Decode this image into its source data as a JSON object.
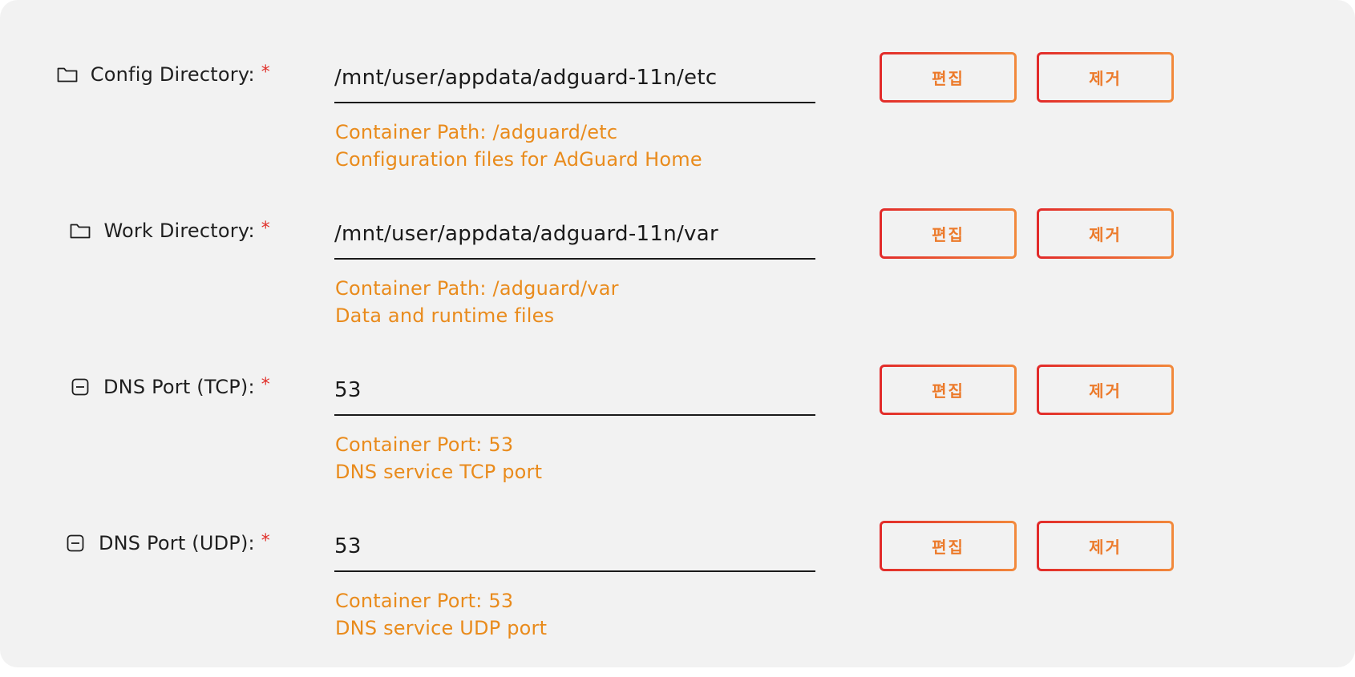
{
  "rows": [
    {
      "icon": "folder-icon",
      "label": "Config Directory:",
      "required": "*",
      "value": "/mnt/user/appdata/adguard-11n/etc",
      "container": "Container Path: /adguard/etc",
      "description": "Configuration files for AdGuard Home",
      "edit_label": "편집",
      "remove_label": "제거"
    },
    {
      "icon": "folder-icon",
      "label": "Work Directory:",
      "required": "*",
      "value": "/mnt/user/appdata/adguard-11n/var",
      "container": "Container Path: /adguard/var",
      "description": "Data and runtime files",
      "edit_label": "편집",
      "remove_label": "제거"
    },
    {
      "icon": "port-icon",
      "label": "DNS Port (TCP):",
      "required": "*",
      "value": "53",
      "container": "Container Port: 53",
      "description": "DNS service TCP port",
      "edit_label": "편집",
      "remove_label": "제거"
    },
    {
      "icon": "port-icon",
      "label": "DNS Port (UDP):",
      "required": "*",
      "value": "53",
      "container": "Container Port: 53",
      "description": "DNS service UDP port",
      "edit_label": "편집",
      "remove_label": "제거"
    }
  ],
  "colors": {
    "background": "#f2f2f2",
    "label": "#1f1f1f",
    "required": "#e0312b",
    "description": "#e98b1c",
    "button_border_start": "#e22a2a",
    "button_border_end": "#f28a3c",
    "button_text": "#ec7a2a"
  }
}
